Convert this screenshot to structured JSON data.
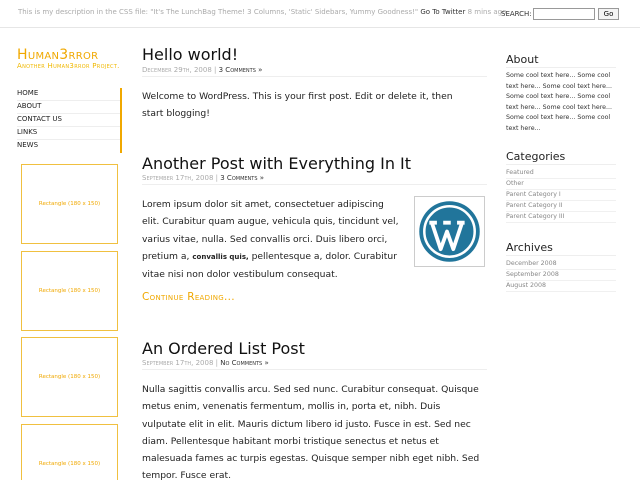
{
  "topbar": {
    "description": "This is my description in the CSS file: \"It's The LunchBag Theme! 3 Columns, 'Static' Sidebars, Yummy Goodness!\"",
    "twitter_link": "Go To Twitter",
    "twitter_ago": "8 mins ago",
    "search_label": "SEARCH:",
    "search_value": "",
    "search_button": "Go"
  },
  "site": {
    "title": "Human3rror",
    "description": "Another Human3rror Project."
  },
  "nav": {
    "items": [
      "HOME",
      "ABOUT",
      "CONTACT US",
      "LINKS",
      "NEWS"
    ]
  },
  "ads": {
    "label": "Rectangle (180 x 150)"
  },
  "posts": [
    {
      "title": "Hello world!",
      "date": "December 29th, 2008",
      "separator": "|",
      "comments": "3 Comments »",
      "body": "Welcome to WordPress. This is your first post. Edit or delete it, then start blogging!"
    },
    {
      "title": "Another Post with Everything In It",
      "date": "September 17th, 2008",
      "separator": "|",
      "comments": "3 Comments »",
      "body_a": "Lorem ipsum dolor sit amet, consectetuer adipiscing elit. Curabitur quam augue, vehicula quis, tincidunt vel, varius vitae, nulla. Sed convallis orci. Duis libero orci, pretium a,",
      "body_bold": "convallis quis,",
      "body_b": "pellentesque a, dolor. Curabitur vitae nisi non dolor vestibulum consequat.",
      "continue": "Continue Reading..."
    },
    {
      "title": "An Ordered List Post",
      "date": "September 17th, 2008",
      "separator": "|",
      "comments": "No Comments »",
      "body": "Nulla sagittis convallis arcu. Sed sed nunc. Curabitur consequat. Quisque metus enim, venenatis fermentum, mollis in, porta et, nibh. Duis vulputate elit in elit. Mauris dictum libero id justo. Fusce in est. Sed nec diam. Pellentesque habitant morbi tristique senectus et netus et malesuada fames ac turpis egestas. Quisque semper nibh eget nibh. Sed tempor. Fusce erat."
    }
  ],
  "sidebar": {
    "about_heading": "About",
    "about_text": "Some cool text here... Some cool text here... Some cool text here... Some cool text here... Some cool text here... Some cool text here... Some cool text here... Some cool text here...",
    "categories_heading": "Categories",
    "categories": [
      "Featured",
      "Other",
      "Parent Category I",
      "Parent Category II",
      "Parent Category III"
    ],
    "archives_heading": "Archives",
    "archives": [
      "December 2008",
      "September 2008",
      "August 2008"
    ]
  },
  "colors": {
    "accent": "#f0a800",
    "wp_blue": "#21759b"
  },
  "icons": {
    "wordpress": "wordpress-logo-icon"
  }
}
